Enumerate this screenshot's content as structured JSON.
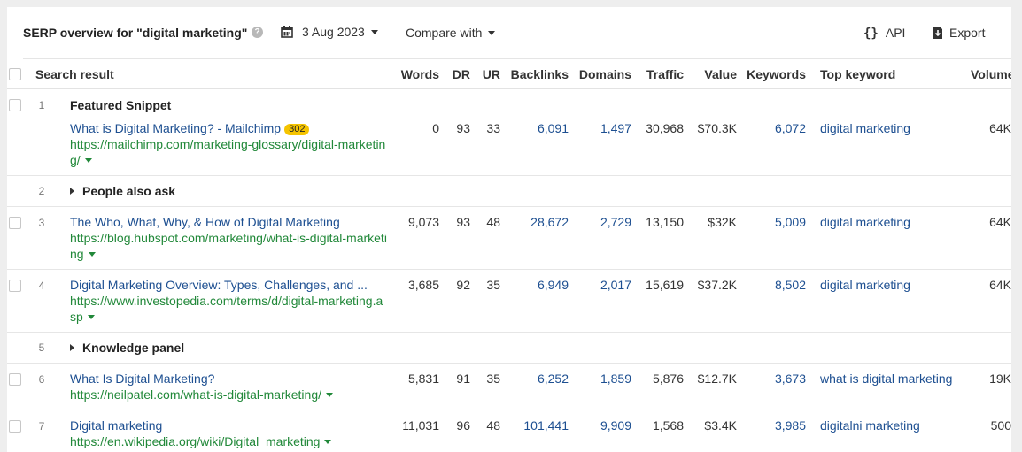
{
  "header": {
    "title": "SERP overview for \"digital marketing\"",
    "help": "?",
    "date": "3 Aug 2023",
    "compare_label": "Compare with",
    "api_label": "API",
    "api_icon": "{}",
    "export_label": "Export"
  },
  "columns": {
    "search_result": "Search result",
    "words": "Words",
    "dr": "DR",
    "ur": "UR",
    "backlinks": "Backlinks",
    "domains": "Domains",
    "traffic": "Traffic",
    "value": "Value",
    "keywords": "Keywords",
    "top_keyword": "Top keyword",
    "volume": "Volume"
  },
  "rows": [
    {
      "num": "1",
      "label": "Featured Snippet",
      "title": "What is Digital Marketing? - Mailchimp",
      "badge": "302",
      "url": "https://mailchimp.com/marketing-glossary/digital-marketing/",
      "words": "0",
      "dr": "93",
      "ur": "33",
      "backlinks": "6,091",
      "domains": "1,497",
      "traffic": "30,968",
      "value": "$70.3K",
      "keywords": "6,072",
      "top_keyword": "digital marketing",
      "volume": "64K"
    },
    {
      "num": "2",
      "section": "People also ask"
    },
    {
      "num": "3",
      "title": "The Who, What, Why, & How of Digital Marketing",
      "url": "https://blog.hubspot.com/marketing/what-is-digital-marketing",
      "words": "9,073",
      "dr": "93",
      "ur": "48",
      "backlinks": "28,672",
      "domains": "2,729",
      "traffic": "13,150",
      "value": "$32K",
      "keywords": "5,009",
      "top_keyword": "digital marketing",
      "volume": "64K"
    },
    {
      "num": "4",
      "title": "Digital Marketing Overview: Types, Challenges, and ...",
      "url": "https://www.investopedia.com/terms/d/digital-marketing.asp",
      "words": "3,685",
      "dr": "92",
      "ur": "35",
      "backlinks": "6,949",
      "domains": "2,017",
      "traffic": "15,619",
      "value": "$37.2K",
      "keywords": "8,502",
      "top_keyword": "digital marketing",
      "volume": "64K"
    },
    {
      "num": "5",
      "section": "Knowledge panel"
    },
    {
      "num": "6",
      "title": "What Is Digital Marketing?",
      "url": "https://neilpatel.com/what-is-digital-marketing/",
      "words": "5,831",
      "dr": "91",
      "ur": "35",
      "backlinks": "6,252",
      "domains": "1,859",
      "traffic": "5,876",
      "value": "$12.7K",
      "keywords": "3,673",
      "top_keyword": "what is digital marketing",
      "volume": "19K"
    },
    {
      "num": "7",
      "title": "Digital marketing",
      "url": "https://en.wikipedia.org/wiki/Digital_marketing",
      "words": "11,031",
      "dr": "96",
      "ur": "48",
      "backlinks": "101,441",
      "domains": "9,909",
      "traffic": "1,568",
      "value": "$3.4K",
      "keywords": "3,985",
      "top_keyword": "digitalni marketing",
      "volume": "500"
    }
  ]
}
